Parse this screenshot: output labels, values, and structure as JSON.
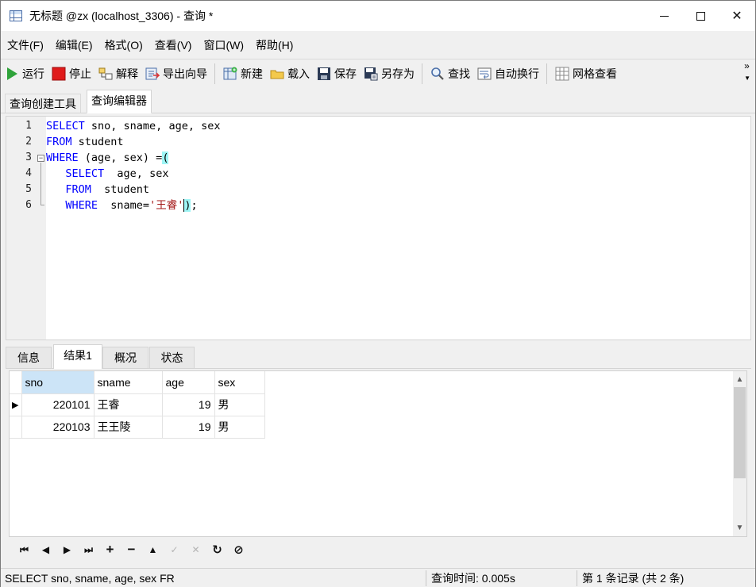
{
  "window": {
    "title": "无标题 @zx (localhost_3306) - 查询 *",
    "controls": {
      "minimize": "—",
      "maximize": "☐",
      "close": "✕"
    }
  },
  "menu": [
    "文件(F)",
    "编辑(E)",
    "格式(O)",
    "查看(V)",
    "窗口(W)",
    "帮助(H)"
  ],
  "toolbar": {
    "run": "运行",
    "stop": "停止",
    "explain": "解释",
    "export_wizard": "导出向导",
    "new": "新建",
    "load": "载入",
    "save": "保存",
    "save_as": "另存为",
    "find": "查找",
    "word_wrap": "自动换行",
    "grid_view": "网格查看",
    "more": "»"
  },
  "top_tabs": {
    "builder": "查询创建工具",
    "editor": "查询编辑器"
  },
  "editor": {
    "line_numbers": [
      "1",
      "2",
      "3",
      "4",
      "5",
      "6"
    ],
    "lines": [
      {
        "kw1": "SELECT",
        "rest": " sno, sname, age, sex"
      },
      {
        "kw1": "FROM",
        "rest": " student"
      },
      {
        "kw1": "WHERE",
        "rest": " (age, sex) =",
        "paren": "("
      },
      {
        "indent": "   ",
        "kw1": "SELECT",
        "rest": "  age, sex"
      },
      {
        "indent": "   ",
        "kw1": "FROM",
        "rest": "  student"
      },
      {
        "indent": "   ",
        "kw1": "WHERE",
        "rest": "  sname=",
        "str": "'王睿'",
        "paren": ")",
        "tail": ";"
      }
    ],
    "fold_marker": "−"
  },
  "bottom_tabs": [
    "信息",
    "结果1",
    "概况",
    "状态"
  ],
  "results": {
    "columns": [
      "sno",
      "sname",
      "age",
      "sex"
    ],
    "rows": [
      [
        "220101",
        "王睿",
        "19",
        "男"
      ],
      [
        "220103",
        "王王陵",
        "19",
        "男"
      ]
    ],
    "current_row_marker": "▶"
  },
  "nav": {
    "first": "⏮",
    "prev": "◀",
    "next": "▶",
    "last": "⏭",
    "add": "+",
    "delete": "−",
    "up": "▲",
    "apply": "✓",
    "cancel": "✕",
    "refresh": "↻",
    "stop": "⊘"
  },
  "status": {
    "sql": "SELECT sno, sname, age, sex FR",
    "query_time": "查询时间: 0.005s",
    "record": "第 1 条记录 (共 2 条)"
  }
}
